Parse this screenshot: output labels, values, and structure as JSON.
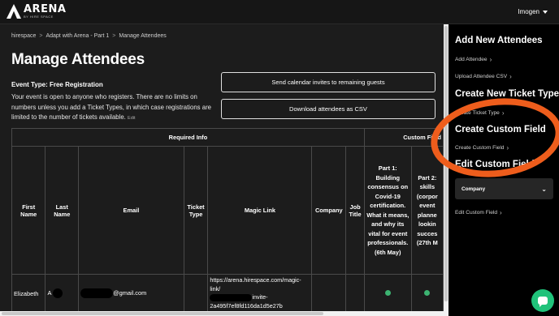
{
  "header": {
    "logo_text": "ARENA",
    "logo_sub": "BY HIRE SPACE",
    "user_name": "Imogen"
  },
  "breadcrumb": [
    "hirespace",
    "Adapt with Arena - Part 1",
    "Manage Attendees"
  ],
  "page": {
    "title": "Manage Attendees",
    "event_type": "Event Type: Free Registration",
    "description": "Your event is open to anyone who registers. There are no limits on numbers unless you add a Ticket Types, in which case registrations are limited to the number of tickets available.",
    "edit_label": "Edit"
  },
  "buttons": {
    "send_invites": "Send calendar invites to remaining guests",
    "download_csv": "Download attendees as CSV"
  },
  "table": {
    "group_required": "Required Info",
    "group_custom": "Custom Field",
    "columns": {
      "first_name": "First Name",
      "last_name": "Last Name",
      "email": "Email",
      "ticket_type": "Ticket Type",
      "magic_link": "Magic Link",
      "company": "Company",
      "job_title": "Job Title",
      "part1": "Part 1: Building consensus on Covid-19 certification. What it means, and why its vital for event professionals. (6th May)",
      "part2": "Part 2: skills (corpor event planne lookin succes (27th M"
    },
    "rows": [
      {
        "first_name": "Elizabeth",
        "last_name": "A",
        "email_suffix": "@gmail.com",
        "magic_link_1": "https://arena.hirespace.com/magic-link/",
        "magic_link_2": "invite-",
        "magic_link_3": "2a495f7ef8fd116da1d5e27b"
      }
    ]
  },
  "sidebar": {
    "add_attendees_title": "Add New Attendees",
    "add_attendee": "Add Attendee",
    "upload_csv": "Upload Attendee CSV",
    "ticket_type_title": "Create New Ticket Type",
    "create_ticket_type": "Create Ticket Type",
    "custom_field_title": "Create Custom Field",
    "create_custom_field": "Create Custom Field",
    "edit_custom_field_title": "Edit Custom Field",
    "select_value": "Company",
    "edit_custom_field": "Edit Custom Field"
  },
  "colors": {
    "annotation_ring": "#ee5d1c",
    "chat_button": "#20c27a",
    "check": "#3cb371"
  }
}
